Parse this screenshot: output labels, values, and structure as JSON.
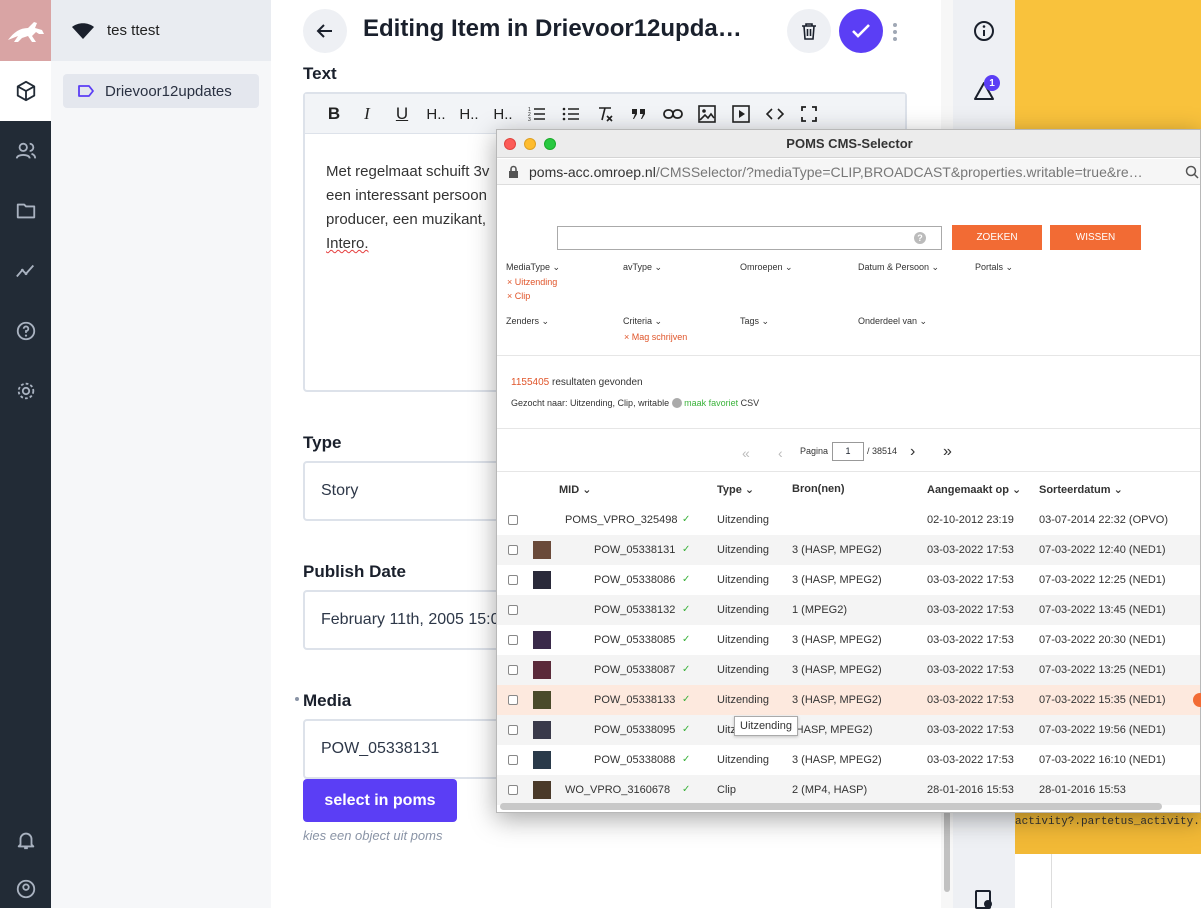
{
  "workspace": {
    "name": "tes ttest"
  },
  "sidebar": {
    "items": [
      {
        "label": "Drievoor12updates"
      }
    ]
  },
  "header": {
    "title": "Editing Item in Drievoor12upda…"
  },
  "editor": {
    "text_label": "Text",
    "toolbar": [
      "B",
      "I",
      "U",
      "H..",
      "H..",
      "H.."
    ],
    "body_lines": [
      "Met regelmaat schuift 3v",
      "een interessant persoon",
      "producer, een muzikant,",
      "Intero."
    ]
  },
  "type": {
    "label": "Type",
    "value": "Story"
  },
  "publish": {
    "label": "Publish Date",
    "value": "February 11th, 2005 15:0"
  },
  "media": {
    "label": "Media",
    "value": "POW_05338131",
    "button": "select in poms",
    "hint": "kies een object uit poms"
  },
  "notifications": {
    "count": "1"
  },
  "popup": {
    "title": "POMS CMS-Selector",
    "url_host": "poms-acc.omroep.nl",
    "url_path": "/CMSSelector/?mediaType=CLIP,BROADCAST&properties.writable=true&re…",
    "search_btn": "ZOEKEN",
    "clear_btn": "WISSEN",
    "filters_row1": [
      "MediaType",
      "avType",
      "Omroepen",
      "Datum & Persoon",
      "Portals"
    ],
    "filters_row2": [
      "Zenders",
      "Criteria",
      "Tags",
      "Onderdeel van"
    ],
    "chips_mediatype": [
      "Uitzending",
      "Clip"
    ],
    "chip_criteria": "Mag schrijven",
    "result_count": "1155405",
    "result_suffix": "resultaten gevonden",
    "search_summary": "Gezocht naar: Uitzending, Clip, writable",
    "favorite": "maak favoriet",
    "csv": "CSV",
    "page_label": "Pagina",
    "page_value": "1",
    "page_total": "/ 38514",
    "columns": [
      "MID",
      "Type",
      "Bron(nen)",
      "Aangemaakt op",
      "Sorteerdatum"
    ],
    "rows": [
      {
        "mid": "POMS_VPRO_325498",
        "type": "Uitzending",
        "bron": "",
        "created": "02-10-2012 23:19",
        "sort": "03-07-2014 22:32 (OPVO)",
        "thumb": false
      },
      {
        "mid": "POW_05338131",
        "type": "Uitzending",
        "bron": "3 (HASP, MPEG2)",
        "created": "03-03-2022 17:53",
        "sort": "07-03-2022 12:40 (NED1)",
        "thumb": true
      },
      {
        "mid": "POW_05338086",
        "type": "Uitzending",
        "bron": "3 (HASP, MPEG2)",
        "created": "03-03-2022 17:53",
        "sort": "07-03-2022 12:25 (NED1)",
        "thumb": true
      },
      {
        "mid": "POW_05338132",
        "type": "Uitzending",
        "bron": "1 (MPEG2)",
        "created": "03-03-2022 17:53",
        "sort": "07-03-2022 13:45 (NED1)",
        "thumb": false
      },
      {
        "mid": "POW_05338085",
        "type": "Uitzending",
        "bron": "3 (HASP, MPEG2)",
        "created": "03-03-2022 17:53",
        "sort": "07-03-2022 20:30 (NED1)",
        "thumb": true
      },
      {
        "mid": "POW_05338087",
        "type": "Uitzending",
        "bron": "3 (HASP, MPEG2)",
        "created": "03-03-2022 17:53",
        "sort": "07-03-2022 13:25 (NED1)",
        "thumb": true
      },
      {
        "mid": "POW_05338133",
        "type": "Uitzending",
        "bron": "3 (HASP, MPEG2)",
        "created": "03-03-2022 17:53",
        "sort": "07-03-2022 15:35 (NED1)",
        "thumb": true
      },
      {
        "mid": "POW_05338095",
        "type": "Uitz",
        "bron": "(HASP, MPEG2)",
        "created": "03-03-2022 17:53",
        "sort": "07-03-2022 19:56 (NED1)",
        "thumb": true
      },
      {
        "mid": "POW_05338088",
        "type": "Uitzending",
        "bron": "3 (HASP, MPEG2)",
        "created": "03-03-2022 17:53",
        "sort": "07-03-2022 16:10 (NED1)",
        "thumb": true
      },
      {
        "mid": "WO_VPRO_3160678",
        "type": "Clip",
        "bron": "2 (MP4, HASP)",
        "created": "28-01-2016 15:53",
        "sort": "28-01-2016 15:53",
        "thumb": true
      }
    ],
    "tooltip": "Uitzending",
    "background_text": "activity?.partetus_activity.ts"
  },
  "colors": {
    "accent": "#5b3ef5",
    "orange": "#f26b34",
    "nav": "#222b36"
  }
}
